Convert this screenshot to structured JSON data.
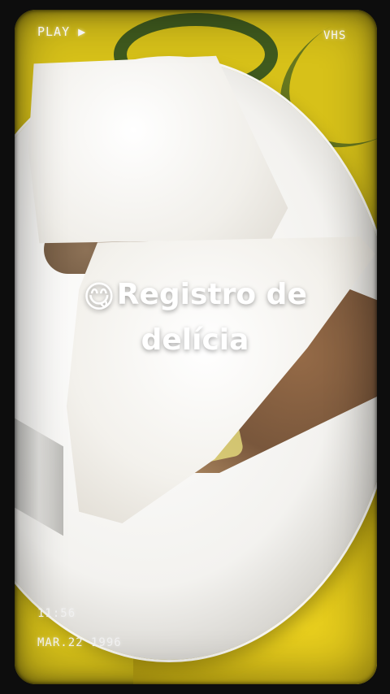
{
  "overlay": {
    "play_label": "PLAY ▶",
    "format_label": "VHS",
    "time": "11:56",
    "date": "MAR.22 1996"
  },
  "caption": {
    "emoji": "😋",
    "line1": "Registro de",
    "line2": "delícia"
  },
  "colors": {
    "table_yellow": "#d7c119",
    "table_green": "#3f5a1e",
    "plate_white": "#f3f2ef",
    "filling_brown": "#6b4527",
    "caption_text": "#ffffff"
  }
}
